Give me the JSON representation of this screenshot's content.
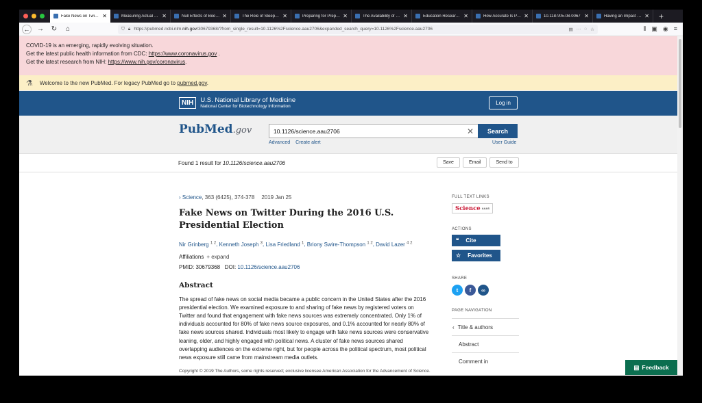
{
  "browser": {
    "tabs": [
      {
        "label": "Fake News on Twitter",
        "active": true
      },
      {
        "label": "Measuring Actual Le…",
        "active": false
      },
      {
        "label": "Null Effects of Boot C…",
        "active": false
      },
      {
        "label": "The Role of Sleep in …",
        "active": false
      },
      {
        "label": "Preparing for Preprin…",
        "active": false
      },
      {
        "label": "The Availability of Re…",
        "active": false
      },
      {
        "label": "Education Research …",
        "active": false
      },
      {
        "label": "How Accurate Is Peer…",
        "active": false
      },
      {
        "label": "10.1187/05-08-0067",
        "active": false
      },
      {
        "label": "Having an Impact (Fa…",
        "active": false
      }
    ],
    "url_prefix": "https://pubmed.ncbi.nlm.",
    "url_domain": "nih.gov",
    "url_rest": "/30679368/?from_single_result=10.1126%2Fscience.aau2706&expanded_search_query=10.1126%2Fscience.aau2706"
  },
  "covid_banner": {
    "line1": "COVID-19 is an emerging, rapidly evolving situation.",
    "line2_text": "Get the latest public health information from CDC: ",
    "line2_link": "https://www.coronavirus.gov",
    "line2_end": " .",
    "line3_text": "Get the latest research from NIH: ",
    "line3_link": "https://www.nih.gov/coronavirus",
    "line3_end": "."
  },
  "welcome": {
    "text": "Welcome to the new PubMed. For legacy PubMed go to ",
    "link": "pubmed.gov",
    "end": "."
  },
  "nih": {
    "badge": "NIH",
    "name": "U.S. National Library of Medicine",
    "sub": "National Center for Biotechnology Information",
    "login_label": "Log in"
  },
  "search": {
    "logo_main": "PubMed",
    "logo_suffix": ".gov",
    "query": "10.1126/science.aau2706",
    "button_label": "Search",
    "advanced": "Advanced",
    "create_alert": "Create alert",
    "user_guide": "User Guide"
  },
  "results": {
    "found_prefix": "Found 1 result for ",
    "found_query": "10.1126/science.aau2706",
    "save": "Save",
    "email": "Email",
    "send_to": "Send to"
  },
  "article": {
    "journal": "Science",
    "citation": ", 363 (6425), 374-378",
    "date": "2019 Jan 25",
    "title": "Fake News on Twitter During the 2016 U.S. Presidential Election",
    "authors": [
      {
        "name": "Nir Grinberg",
        "aff": "1 2"
      },
      {
        "name": "Kenneth Joseph",
        "aff": "3"
      },
      {
        "name": "Lisa Friedland",
        "aff": "1"
      },
      {
        "name": "Briony Swire-Thompson",
        "aff": "1 2"
      },
      {
        "name": "David Lazer",
        "aff": "4 2"
      }
    ],
    "affiliations_label": "Affiliations",
    "expand_label": "+ expand",
    "pmid_label": "PMID: 30679368",
    "doi_label": "DOI: ",
    "doi": "10.1126/science.aau2706",
    "abstract_heading": "Abstract",
    "abstract": "The spread of fake news on social media became a public concern in the United States after the 2016 presidential election. We examined exposure to and sharing of fake news by registered voters on Twitter and found that engagement with fake news sources was extremely concentrated. Only 1% of individuals accounted for 80% of fake news source exposures, and 0.1% accounted for nearly 80% of fake news sources shared. Individuals most likely to engage with fake news sources were conservative leaning, older, and highly engaged with political news. A cluster of fake news sources shared overlapping audiences on the extreme right, but for people across the political spectrum, most political news exposure still came from mainstream media outlets.",
    "copyright": "Copyright © 2019 The Authors, some rights reserved; exclusive licensee American Association for the Advancement of Science. No claim to original U.S. Government Works."
  },
  "sidebar": {
    "full_text_heading": "FULL TEXT LINKS",
    "science_logo": "Science",
    "science_logo_small": "AAAS",
    "actions_heading": "ACTIONS",
    "cite": "Cite",
    "favorites": "Favorites",
    "share_heading": "SHARE",
    "page_nav_heading": "PAGE NAVIGATION",
    "nav_items": [
      "Title & authors",
      "Abstract",
      "Comment in"
    ]
  },
  "feedback_label": "Feedback",
  "colors": {
    "nih_blue": "#20558a",
    "covid_bg": "#f8d7da",
    "welcome_bg": "#fcefc6",
    "feedback_green": "#0b6e4f"
  }
}
